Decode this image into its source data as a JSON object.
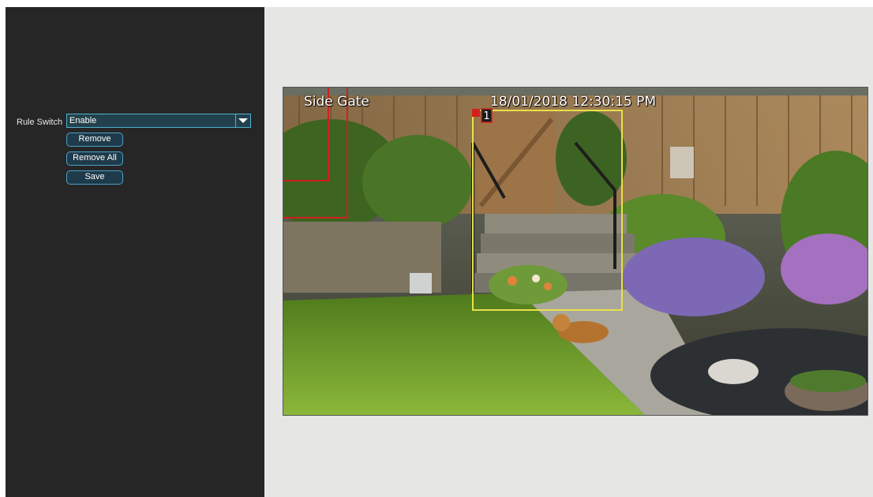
{
  "left_panel": {
    "rule_switch_label": "Rule Switch",
    "rule_switch_value": "Enable",
    "buttons": {
      "remove": "Remove",
      "remove_all": "Remove All",
      "save": "Save"
    }
  },
  "video": {
    "camera_name": "Side Gate",
    "timestamp": "18/01/2018 12:30:15 PM",
    "rule_marker": "1"
  },
  "colors": {
    "panel_bg": "#262626",
    "preview_bg": "#e6e6e4",
    "accent": "#4fb2cf",
    "rule_box_yellow": "#e8e04a",
    "rule_box_red": "#d41e1e"
  }
}
